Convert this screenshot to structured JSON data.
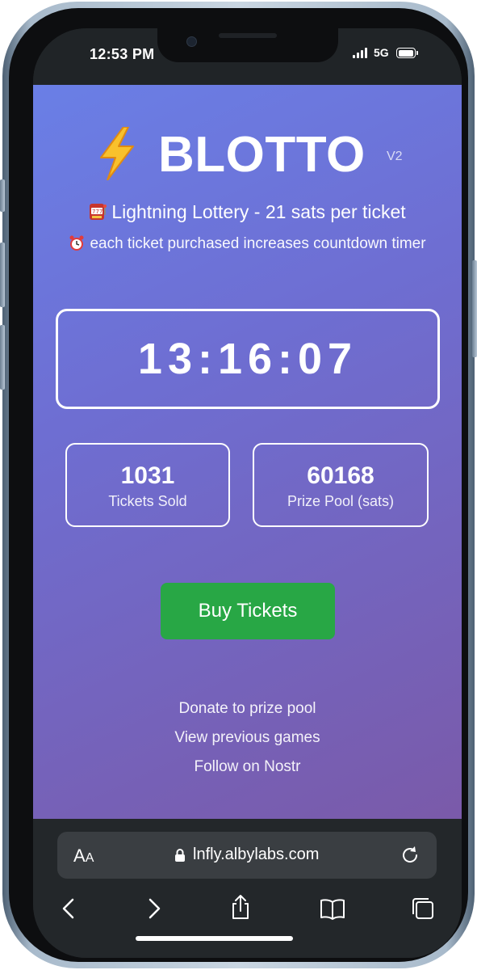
{
  "status_bar": {
    "time": "12:53 PM",
    "network": "5G"
  },
  "app": {
    "brand": "BLOTTO",
    "version": "V2",
    "subtitle": "Lightning Lottery - 21 sats per ticket",
    "subtitle_emoji": "slot-machine",
    "note": "each ticket purchased increases countdown timer",
    "note_emoji": "alarm-clock",
    "countdown": "13:16:07",
    "stats": [
      {
        "value": "1031",
        "label": "Tickets Sold"
      },
      {
        "value": "60168",
        "label": "Prize Pool (sats)"
      }
    ],
    "buy_label": "Buy Tickets",
    "buy_color": "#28a745",
    "links": [
      "Donate to prize pool",
      "View previous games",
      "Follow on Nostr"
    ],
    "gradient": [
      "#6a7fe6",
      "#7a5aa9"
    ]
  },
  "browser": {
    "text_size_label_big": "A",
    "text_size_label_small": "A",
    "url": "lnfly.albylabs.com",
    "toolbar_icons": [
      "back-icon",
      "forward-icon",
      "share-icon",
      "bookmarks-icon",
      "tabs-icon"
    ]
  }
}
